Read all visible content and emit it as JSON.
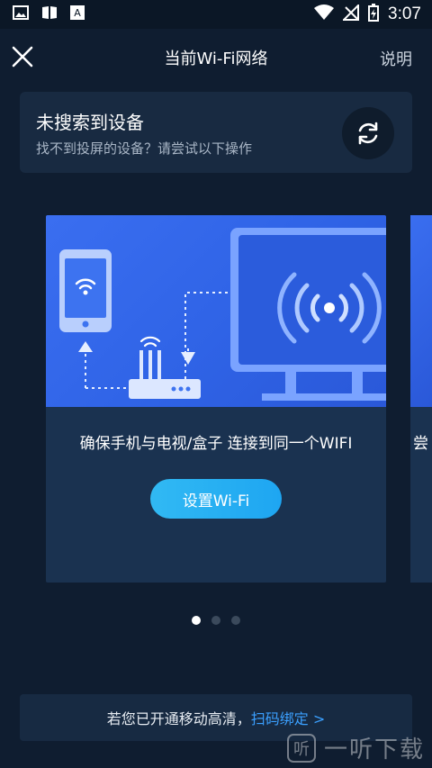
{
  "status_bar": {
    "time": "3:07",
    "icons_left": [
      "image-icon",
      "book-icon",
      "font-icon"
    ],
    "icons_right": [
      "wifi-icon",
      "no-signal-icon",
      "battery-charging-icon"
    ]
  },
  "header": {
    "title": "当前Wi-Fi网络",
    "help_label": "说明"
  },
  "search_card": {
    "title": "未搜索到设备",
    "subtitle": "找不到投屏的设备？请尝试以下操作"
  },
  "carousel": {
    "cards": [
      {
        "description": "确保手机与电视/盒子 连接到同一个WIFI",
        "button_label": "设置Wi-Fi"
      }
    ],
    "next_peek_text": "尝",
    "page_count": 3,
    "active_index": 0
  },
  "bottom_bar": {
    "text": "若您已开通移动高清，",
    "link_label": "扫码绑定 >"
  },
  "watermark": {
    "text": "一听下载"
  },
  "colors": {
    "background": "#0f1d30",
    "card": "#1a3250",
    "illustration_blue": "#3a6ef0",
    "button": "#31b9f3",
    "link": "#3ba0ff"
  }
}
